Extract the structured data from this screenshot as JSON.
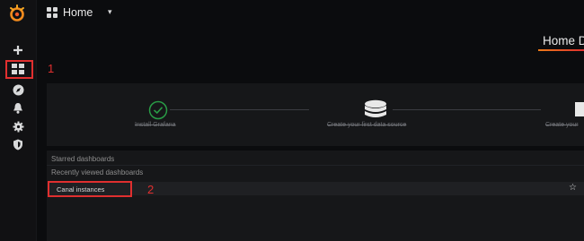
{
  "topbar": {
    "title": "Home",
    "caret": "▾"
  },
  "main": {
    "heading": "Home D"
  },
  "annotations": {
    "first": "1",
    "second": "2"
  },
  "steps": [
    {
      "label": "Install Grafana",
      "icon": "check-circle-icon"
    },
    {
      "label": "Create your first data source",
      "icon": "database-icon"
    },
    {
      "label": "Create your",
      "icon": "dashboard-icon"
    }
  ],
  "dashboards": {
    "starred_label": "Starred dashboards",
    "recent_label": "Recently viewed dashboards",
    "items": [
      {
        "name": "Canal instances",
        "star": "☆"
      }
    ]
  },
  "colors": {
    "accent": "#eb7b18",
    "success": "#299c46",
    "annotation": "#e02f2f"
  }
}
